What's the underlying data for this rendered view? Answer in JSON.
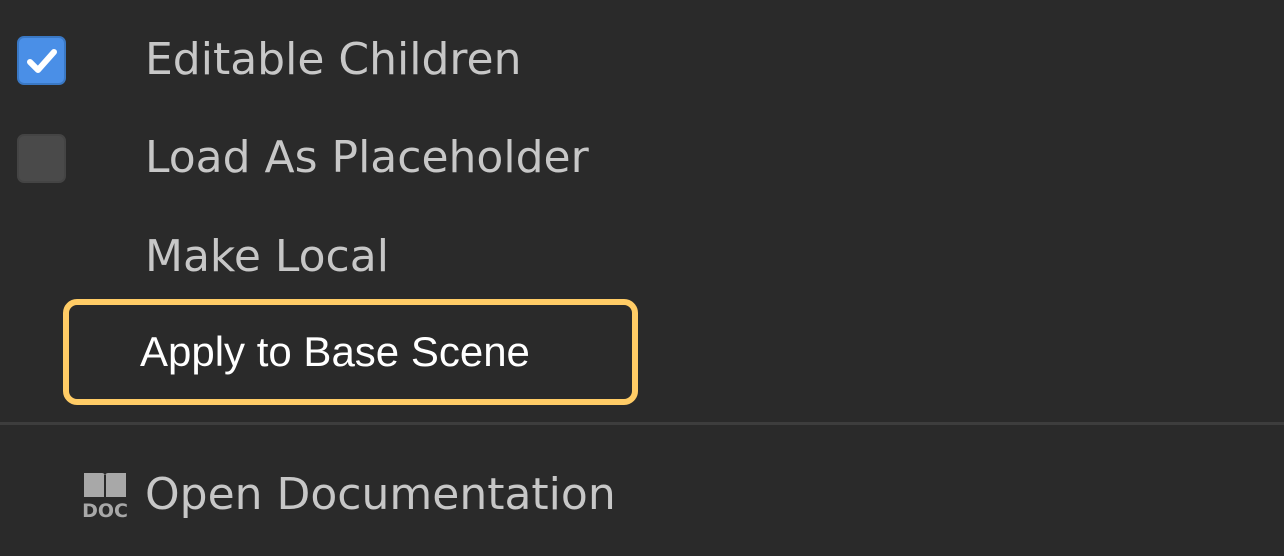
{
  "context_menu": {
    "items": [
      {
        "label": "Editable Children",
        "checkbox": "checked"
      },
      {
        "label": "Load As Placeholder",
        "checkbox": "unchecked"
      },
      {
        "label": "Make Local"
      },
      {
        "label": "Apply to Base Scene",
        "highlighted": true
      },
      {
        "label": "Open Documentation",
        "icon": "doc-book-icon"
      }
    ],
    "doc_icon_text": "DOC"
  },
  "colors": {
    "background": "#2a2a2a",
    "text": "#c7c7c7",
    "highlight_text": "#ffffff",
    "checkbox_checked": "#4a8fe7",
    "checkbox_unchecked": "#4a4a4a",
    "highlight_border": "#ffcc66",
    "separator": "#3d3d3d"
  }
}
